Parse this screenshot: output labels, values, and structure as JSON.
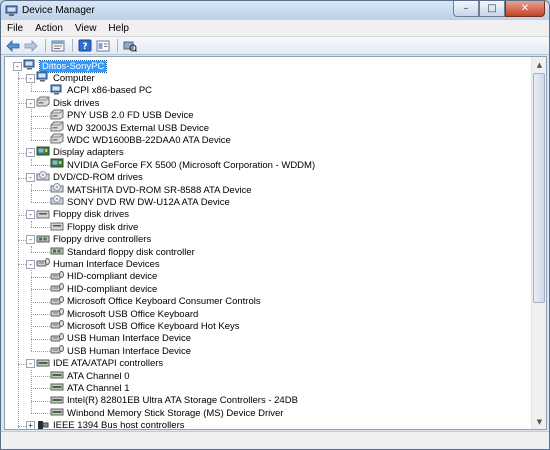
{
  "window": {
    "title": "Device Manager",
    "controls": {
      "minimize": "–",
      "maximize": "□",
      "close": "✕"
    }
  },
  "menu": [
    "File",
    "Action",
    "View",
    "Help"
  ],
  "toolbar": {
    "buttons": [
      "back-arrow-icon",
      "forward-arrow-icon",
      "properties-icon",
      "help-icon",
      "view-icon",
      "scan-hardware-icon"
    ]
  },
  "tree": {
    "root": "Dittos-SonyPC",
    "categories": [
      {
        "label": "Computer",
        "icon": "computer-icon",
        "children": [
          "ACPI x86-based PC"
        ]
      },
      {
        "label": "Disk drives",
        "icon": "disk-drive-icon",
        "children": [
          "PNY USB 2.0 FD USB Device",
          "WD 3200JS External USB Device",
          "WDC WD1600BB-22DAA0 ATA Device"
        ]
      },
      {
        "label": "Display adapters",
        "icon": "display-adapter-icon",
        "children": [
          "NVIDIA GeForce FX 5500 (Microsoft Corporation - WDDM)"
        ]
      },
      {
        "label": "DVD/CD-ROM drives",
        "icon": "dvd-drive-icon",
        "children": [
          "MATSHITA DVD-ROM SR-8588 ATA Device",
          "SONY DVD RW DW-U12A ATA Device"
        ]
      },
      {
        "label": "Floppy disk drives",
        "icon": "floppy-drive-icon",
        "children": [
          "Floppy disk drive"
        ]
      },
      {
        "label": "Floppy drive controllers",
        "icon": "floppy-controller-icon",
        "children": [
          "Standard floppy disk controller"
        ]
      },
      {
        "label": "Human Interface Devices",
        "icon": "hid-icon",
        "children": [
          "HID-compliant device",
          "HID-compliant device",
          "Microsoft Office Keyboard Consumer Controls",
          "Microsoft USB Office Keyboard",
          "Microsoft USB Office Keyboard Hot Keys",
          "USB Human Interface Device",
          "USB Human Interface Device"
        ]
      },
      {
        "label": "IDE ATA/ATAPI controllers",
        "icon": "ide-controller-icon",
        "children": [
          "ATA Channel 0",
          "ATA Channel 1",
          "Intel(R) 82801EB Ultra ATA Storage Controllers - 24DB",
          "Winbond Memory Stick Storage (MS) Device Driver"
        ]
      },
      {
        "label": "IEEE 1394 Bus host controllers",
        "icon": "ieee1394-icon",
        "children": []
      }
    ]
  },
  "colors": {
    "selection": "#3399ff",
    "titlebar": "#bcd0e8",
    "close": "#c3432a"
  }
}
